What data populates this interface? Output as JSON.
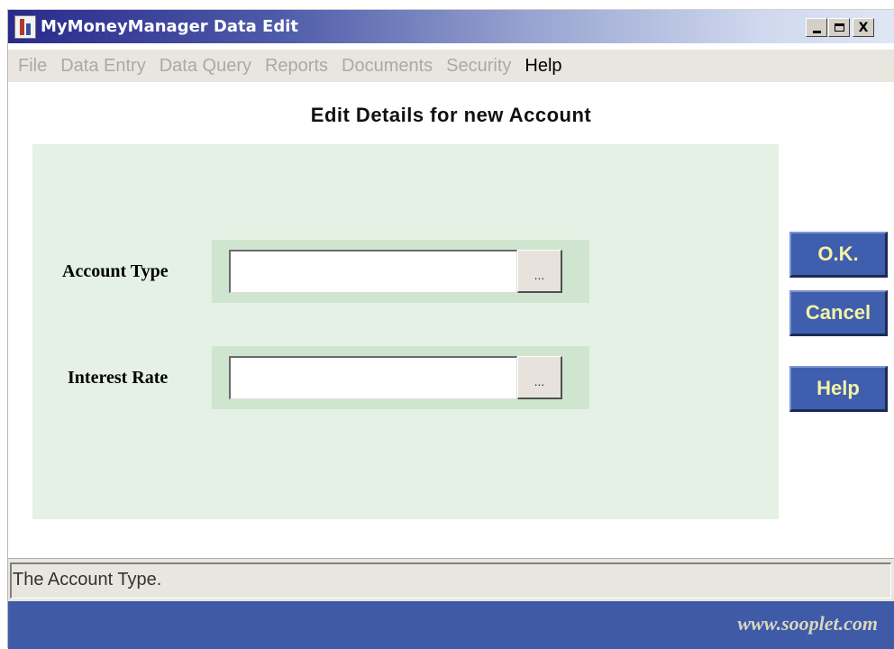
{
  "window": {
    "title": "MyMoneyManager Data Edit",
    "minimize_label": "_",
    "maximize_label": "□",
    "close_label": "X"
  },
  "menu": {
    "items": [
      {
        "label": "File",
        "enabled": false
      },
      {
        "label": "Data Entry",
        "enabled": false
      },
      {
        "label": "Data Query",
        "enabled": false
      },
      {
        "label": "Reports",
        "enabled": false
      },
      {
        "label": "Documents",
        "enabled": false
      },
      {
        "label": "Security",
        "enabled": false
      },
      {
        "label": "Help",
        "enabled": true
      }
    ]
  },
  "form": {
    "heading": "Edit Details for new Account",
    "fields": [
      {
        "label": "Account Type",
        "value": "",
        "browse_label": "..."
      },
      {
        "label": "Interest Rate",
        "value": "",
        "browse_label": "..."
      }
    ]
  },
  "buttons": {
    "ok": "O.K.",
    "cancel": "Cancel",
    "help": "Help"
  },
  "status": {
    "text": "The Account Type."
  },
  "footer": {
    "link": "www.sooplet.com"
  },
  "colors": {
    "panel_bg": "#e5f1e4",
    "field_bg": "#cfe5cf",
    "button_bg": "#3f5fae",
    "button_text": "#f4f3a6",
    "footer_bg": "#3f5aa7"
  }
}
